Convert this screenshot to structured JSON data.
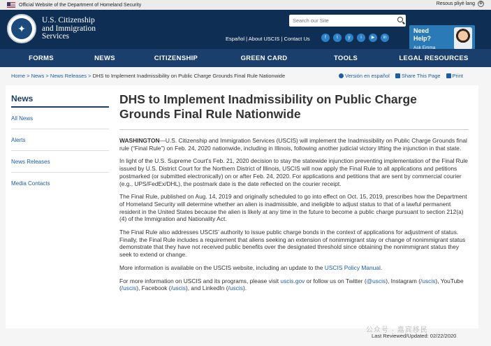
{
  "topbar": {
    "official": "Official Website of the Department of Homeland Security",
    "lang": "Resous pliyè lang"
  },
  "header": {
    "agency_line1": "U.S. Citizenship",
    "agency_line2": "and Immigration",
    "agency_line3": "Services",
    "search_placeholder": "Search our Site",
    "links": "Español | About USCIS | Contact Us",
    "social": [
      "f",
      "t",
      "y",
      "i",
      "▶",
      "in"
    ],
    "help_line1": "Need",
    "help_line2": "Help?",
    "help_line3": "Ask Emma"
  },
  "nav": [
    "FORMS",
    "NEWS",
    "CITIZENSHIP",
    "GREEN CARD",
    "TOOLS",
    "LEGAL RESOURCES"
  ],
  "breadcrumb": {
    "home": "Home",
    "news": "News",
    "releases": "News Releases",
    "current": "DHS to Implement Inadmissibility on Public Charge Grounds Final Rule Nationwide",
    "sep": " > "
  },
  "tools": {
    "spanish": "Versión en español",
    "share": "Share This Page",
    "print": "Print"
  },
  "sidebar": {
    "title": "News",
    "items": [
      "All News",
      "Alerts",
      "News Releases",
      "Media Contacts"
    ]
  },
  "article": {
    "title": "DHS to Implement Inadmissibility on Public Charge Grounds Final Rule Nationwide",
    "dateline": "WASHINGTON",
    "p1": "—U.S. Citizenship and Immigration Services (USCIS) will implement the Inadmissibility on Public Charge Grounds final rule (“Final Rule”) on Feb. 24, 2020 nationwide, including in Illinois, following another judicial victory lifting the injunction in that state.",
    "p2": "In light of the U.S. Supreme Court’s Feb. 21, 2020 decision to stay the statewide injunction preventing implementation of the Final Rule issued by U.S. District Court for the Northern District of Illinois, USCIS will now apply the Final Rule to all applications and petitions postmarked (or submitted electronically) on or after Feb. 24, 2020. For applications and petitions that are sent by commercial courier (e.g., UPS/FedEx/DHL), the postmark date is the date reflected on the courier receipt.",
    "p3": "The Final Rule, published on Aug. 14, 2019 and originally scheduled to go into effect on Oct. 15, 2019, prescribes how the Department of Homeland Security will determine whether an alien is inadmissible, and ineligible to adjust status to that of a lawful permanent resident in the United States because the alien is likely at any time in the future to become a public charge pursuant to section 212(a)(4) of the Immigration and Nationality Act.",
    "p4": "The Final Rule also addresses USCIS’ authority to issue public charge bonds in the context of applications for adjustment of status. Finally, the Final Rule includes a requirement that aliens seeking an extension of nonimmigrant stay or change of nonimmigrant status demonstrate that they have not received public benefits over the designated threshold since obtaining the nonimmigrant status they seek to extend or change.",
    "p5_text": "More information is available on the USCIS website, including an update to the ",
    "p5_link": "USCIS Policy Manual",
    "p5_end": ".",
    "p6_a": "For more information on USCIS and its programs, please visit ",
    "p6_site": "uscis.gov",
    "p6_b": " or follow us on Twitter (",
    "p6_tw": "@uscis",
    "p6_c": "), Instagram (",
    "p6_ig": "/uscis",
    "p6_d": "), YouTube (",
    "p6_yt": "/uscis",
    "p6_e": "), Facebook (",
    "p6_fb": "/uscis",
    "p6_f": "), and LinkedIn (",
    "p6_li": "/uscis",
    "p6_g": ")."
  },
  "footer": {
    "updated": "Last Reviewed/Updated: 02/22/2020"
  },
  "watermark": "公众号 · 嘉宾移民"
}
